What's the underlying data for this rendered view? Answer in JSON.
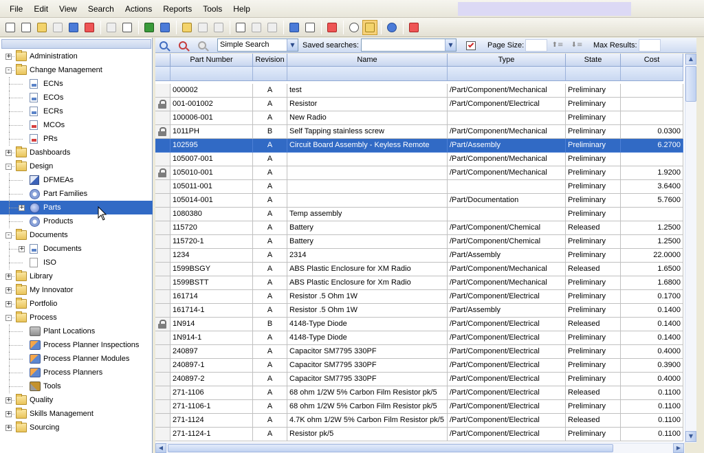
{
  "menu": [
    "File",
    "Edit",
    "View",
    "Search",
    "Actions",
    "Reports",
    "Tools",
    "Help"
  ],
  "toolbar": {
    "buttons": [
      {
        "icon": "new-icon",
        "tone": "",
        "dis": false
      },
      {
        "icon": "open-preview-icon",
        "tone": "",
        "dis": false
      },
      {
        "icon": "open-folder-icon",
        "tone": "c-yellow",
        "dis": false
      },
      {
        "icon": "save-icon",
        "tone": "",
        "dis": true
      },
      {
        "icon": "save-as-icon",
        "tone": "c-blue",
        "dis": false
      },
      {
        "icon": "delete-icon",
        "tone": "c-red",
        "dis": false
      },
      {
        "sep": true
      },
      {
        "icon": "copy-icon",
        "tone": "",
        "dis": true
      },
      {
        "icon": "print-icon",
        "tone": "",
        "dis": false
      },
      {
        "sep": true
      },
      {
        "icon": "excel-icon",
        "tone": "c-green",
        "dis": false
      },
      {
        "icon": "word-icon",
        "tone": "c-blue",
        "dis": false
      },
      {
        "sep": true
      },
      {
        "icon": "lock-icon",
        "tone": "c-yellow",
        "dis": false
      },
      {
        "icon": "unlock-icon",
        "tone": "",
        "dis": true
      },
      {
        "icon": "undo-icon",
        "tone": "",
        "dis": true
      },
      {
        "sep": true
      },
      {
        "icon": "document-icon",
        "tone": "",
        "dis": false
      },
      {
        "icon": "promote-icon",
        "tone": "",
        "dis": true
      },
      {
        "icon": "revert-icon",
        "tone": "",
        "dis": true
      },
      {
        "sep": true
      },
      {
        "icon": "arrow-icon",
        "tone": "c-blue",
        "dis": false
      },
      {
        "icon": "where-used-icon",
        "tone": "",
        "dis": false
      },
      {
        "sep": true
      },
      {
        "icon": "report-icon",
        "tone": "c-red",
        "dis": false
      },
      {
        "sep": true
      },
      {
        "icon": "globe-icon",
        "tone": "c-circle",
        "dis": false
      },
      {
        "icon": "grid-view-icon",
        "tone": "c-yellow",
        "dis": false,
        "active": true
      },
      {
        "sep": true
      },
      {
        "icon": "help-icon",
        "tone": "c-blue c-circle",
        "dis": false
      },
      {
        "sep": true
      },
      {
        "icon": "logout-icon",
        "tone": "c-red",
        "dis": false
      }
    ]
  },
  "tree": [
    {
      "label": "Administration",
      "level": 0,
      "icon": "folder",
      "exp": "+"
    },
    {
      "label": "Change Management",
      "level": 0,
      "icon": "folder",
      "exp": "-"
    },
    {
      "label": "ECNs",
      "level": 1,
      "icon": "doc"
    },
    {
      "label": "ECOs",
      "level": 1,
      "icon": "doc"
    },
    {
      "label": "ECRs",
      "level": 1,
      "icon": "doc"
    },
    {
      "label": "MCOs",
      "level": 1,
      "icon": "doc doc-red"
    },
    {
      "label": "PRs",
      "level": 1,
      "icon": "doc doc-red"
    },
    {
      "label": "Dashboards",
      "level": 0,
      "icon": "folder",
      "exp": "+"
    },
    {
      "label": "Design",
      "level": 0,
      "icon": "folder",
      "exp": "-"
    },
    {
      "label": "DFMEAs",
      "level": 1,
      "icon": "pencil"
    },
    {
      "label": "Part Families",
      "level": 1,
      "icon": "gear"
    },
    {
      "label": "Parts",
      "level": 1,
      "icon": "item",
      "exp": "+",
      "selected": true
    },
    {
      "label": "Products",
      "level": 1,
      "icon": "gear"
    },
    {
      "label": "Documents",
      "level": 0,
      "icon": "folder",
      "exp": "-"
    },
    {
      "label": "Documents",
      "level": 1,
      "icon": "doc",
      "exp": "+"
    },
    {
      "label": "ISO",
      "level": 1,
      "icon": "iso"
    },
    {
      "label": "Library",
      "level": 0,
      "icon": "folder",
      "exp": "+"
    },
    {
      "label": "My Innovator",
      "level": 0,
      "icon": "folder",
      "exp": "+"
    },
    {
      "label": "Portfolio",
      "level": 0,
      "icon": "folder",
      "exp": "+"
    },
    {
      "label": "Process",
      "level": 0,
      "icon": "folder",
      "exp": "-"
    },
    {
      "label": "Plant Locations",
      "level": 1,
      "icon": "plant"
    },
    {
      "label": "Process Planner Inspections",
      "level": 1,
      "icon": "proc"
    },
    {
      "label": "Process Planner Modules",
      "level": 1,
      "icon": "proc"
    },
    {
      "label": "Process Planners",
      "level": 1,
      "icon": "proc"
    },
    {
      "label": "Tools",
      "level": 1,
      "icon": "tools"
    },
    {
      "label": "Quality",
      "level": 0,
      "icon": "folder",
      "exp": "+"
    },
    {
      "label": "Skills Management",
      "level": 0,
      "icon": "folder",
      "exp": "+"
    },
    {
      "label": "Sourcing",
      "level": 0,
      "icon": "folder",
      "exp": "+"
    }
  ],
  "search": {
    "mode": "Simple Search",
    "saved_label": "Saved searches:",
    "saved_value": "",
    "page_size_label": "Page Size:",
    "page_size_value": "",
    "max_results_label": "Max Results:",
    "max_results_value": ""
  },
  "grid": {
    "columns": [
      "",
      "Part Number",
      "Revision",
      "Name",
      "Type",
      "State",
      "Cost"
    ],
    "rows": [
      {
        "lock": false,
        "cells": [
          "000002",
          "A",
          "test",
          "/Part/Component/Mechanical",
          "Preliminary",
          ""
        ]
      },
      {
        "lock": true,
        "cells": [
          "001-001002",
          "A",
          "Resistor",
          "/Part/Component/Electrical",
          "Preliminary",
          ""
        ]
      },
      {
        "lock": false,
        "cells": [
          "100006-001",
          "A",
          "New Radio",
          "",
          "Preliminary",
          ""
        ]
      },
      {
        "lock": true,
        "cells": [
          "1011PH",
          "B",
          "Self Tapping stainless screw",
          "/Part/Component/Mechanical",
          "Preliminary",
          "0.0300"
        ]
      },
      {
        "lock": false,
        "selected": true,
        "cells": [
          "102595",
          "A",
          "Circuit Board Assembly - Keyless Remote",
          "/Part/Assembly",
          "Preliminary",
          "6.2700"
        ]
      },
      {
        "lock": false,
        "cells": [
          "105007-001",
          "A",
          "",
          "/Part/Component/Mechanical",
          "Preliminary",
          ""
        ]
      },
      {
        "lock": true,
        "cells": [
          "105010-001",
          "A",
          "",
          "/Part/Component/Mechanical",
          "Preliminary",
          "1.9200"
        ]
      },
      {
        "lock": false,
        "cells": [
          "105011-001",
          "A",
          "",
          "",
          "Preliminary",
          "3.6400"
        ]
      },
      {
        "lock": false,
        "cells": [
          "105014-001",
          "A",
          "",
          "/Part/Documentation",
          "Preliminary",
          "5.7600"
        ]
      },
      {
        "lock": false,
        "cells": [
          "1080380",
          "A",
          "Temp assembly",
          "",
          "Preliminary",
          ""
        ]
      },
      {
        "lock": false,
        "cells": [
          "115720",
          "A",
          "Battery",
          "/Part/Component/Chemical",
          "Released",
          "1.2500"
        ]
      },
      {
        "lock": false,
        "cells": [
          "115720-1",
          "A",
          "Battery",
          "/Part/Component/Chemical",
          "Preliminary",
          "1.2500"
        ]
      },
      {
        "lock": false,
        "cells": [
          "1234",
          "A",
          "2314",
          "/Part/Assembly",
          "Preliminary",
          "22.0000"
        ]
      },
      {
        "lock": false,
        "cells": [
          "1599BSGY",
          "A",
          "ABS Plastic Enclosure for XM Radio",
          "/Part/Component/Mechanical",
          "Released",
          "1.6500"
        ]
      },
      {
        "lock": false,
        "cells": [
          "1599BSTT",
          "A",
          "ABS Plastic Enclosure for Xm Radio",
          "/Part/Component/Mechanical",
          "Preliminary",
          "1.6800"
        ]
      },
      {
        "lock": false,
        "cells": [
          "161714",
          "A",
          "Resistor .5 Ohm 1W",
          "/Part/Component/Electrical",
          "Preliminary",
          "0.1700"
        ]
      },
      {
        "lock": false,
        "cells": [
          "161714-1",
          "A",
          "Resistor .5 Ohm 1W",
          "/Part/Assembly",
          "Preliminary",
          "0.1400"
        ]
      },
      {
        "lock": true,
        "cells": [
          "1N914",
          "B",
          "4148-Type Diode",
          "/Part/Component/Electrical",
          "Released",
          "0.1400"
        ]
      },
      {
        "lock": false,
        "cells": [
          "1N914-1",
          "A",
          "4148-Type Diode",
          "/Part/Component/Electrical",
          "Preliminary",
          "0.1400"
        ]
      },
      {
        "lock": false,
        "cells": [
          "240897",
          "A",
          "Capacitor SM7795 330PF",
          "/Part/Component/Electrical",
          "Preliminary",
          "0.4000"
        ]
      },
      {
        "lock": false,
        "cells": [
          "240897-1",
          "A",
          "Capacitor SM7795 330PF",
          "/Part/Component/Electrical",
          "Preliminary",
          "0.3900"
        ]
      },
      {
        "lock": false,
        "cells": [
          "240897-2",
          "A",
          "Capacitor SM7795 330PF",
          "/Part/Component/Electrical",
          "Preliminary",
          "0.4000"
        ]
      },
      {
        "lock": false,
        "cells": [
          "271-1106",
          "A",
          "68 ohm 1/2W 5% Carbon Film Resistor pk/5",
          "/Part/Component/Electrical",
          "Released",
          "0.1100"
        ]
      },
      {
        "lock": false,
        "cells": [
          "271-1106-1",
          "A",
          "68 ohm 1/2W 5% Carbon Film Resistor pk/5",
          "/Part/Component/Electrical",
          "Preliminary",
          "0.1100"
        ]
      },
      {
        "lock": false,
        "cells": [
          "271-1124",
          "A",
          "4.7K ohm 1/2W 5% Carbon Film Resistor pk/5",
          "/Part/Component/Electrical",
          "Released",
          "0.1100"
        ]
      },
      {
        "lock": false,
        "cells": [
          "271-1124-1",
          "A",
          "Resistor pk/5",
          "/Part/Component/Electrical",
          "Preliminary",
          "0.1100"
        ]
      }
    ]
  }
}
